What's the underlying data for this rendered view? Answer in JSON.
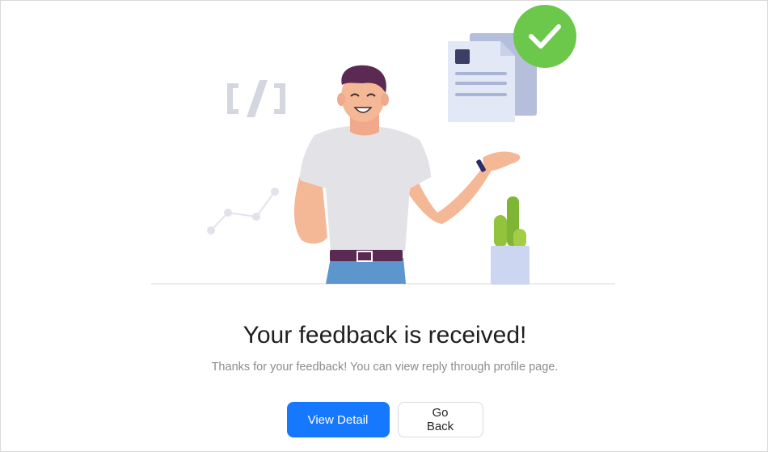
{
  "result": {
    "title": "Your feedback is received!",
    "subtitle": "Thanks for your feedback! You can view reply through profile page.",
    "status": "success"
  },
  "actions": {
    "primary_label": "View Detail",
    "secondary_label": "Go Back"
  },
  "colors": {
    "primary": "#1677ff",
    "success": "#6cc84a",
    "title_text": "#1f1f1f",
    "subtitle_text": "#8c8c8c"
  },
  "illustration": {
    "icons": [
      "code-brackets-icon",
      "line-chart-icon",
      "document-icon",
      "checkmark-icon",
      "cactus-plant",
      "person-figure"
    ]
  }
}
